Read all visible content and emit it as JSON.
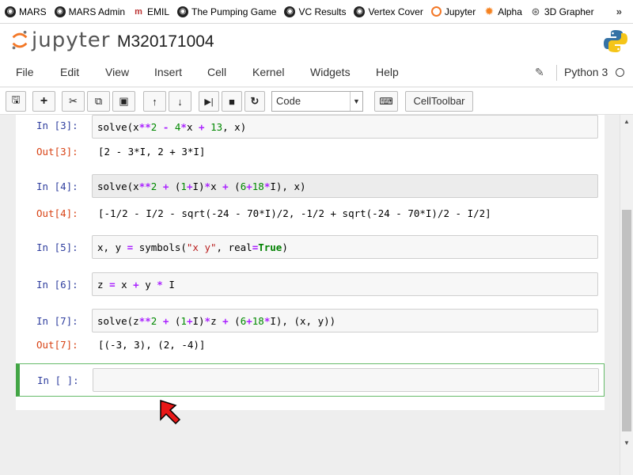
{
  "bookmarks": [
    "MARS",
    "MARS Admin",
    "EMIL",
    "The Pumping Game",
    "VC Results",
    "Vertex Cover",
    "Jupyter",
    "Alpha",
    "3D Grapher"
  ],
  "header": {
    "logo_text": "jupyter",
    "notebook_name": "M320171004"
  },
  "menu": [
    "File",
    "Edit",
    "View",
    "Insert",
    "Cell",
    "Kernel",
    "Widgets",
    "Help"
  ],
  "kernel": {
    "name": "Python 3"
  },
  "toolbar": {
    "cell_type": "Code",
    "celltoolbar_label": "CellToolbar"
  },
  "cells": [
    {
      "in_prompt": "In [3]:",
      "out_prompt": "Out[3]:",
      "output": "[2 - 3*I, 2 + 3*I]"
    },
    {
      "in_prompt": "In [4]:",
      "out_prompt": "Out[4]:",
      "output": "[-1/2 - I/2 - sqrt(-24 - 70*I)/2, -1/2 + sqrt(-24 - 70*I)/2 - I/2]"
    },
    {
      "in_prompt": "In [5]:"
    },
    {
      "in_prompt": "In [6]:"
    },
    {
      "in_prompt": "In [7]:",
      "out_prompt": "Out[7]:",
      "output": "[(-3, 3), (2, -4)]"
    },
    {
      "in_prompt": "In [ ]:"
    }
  ]
}
